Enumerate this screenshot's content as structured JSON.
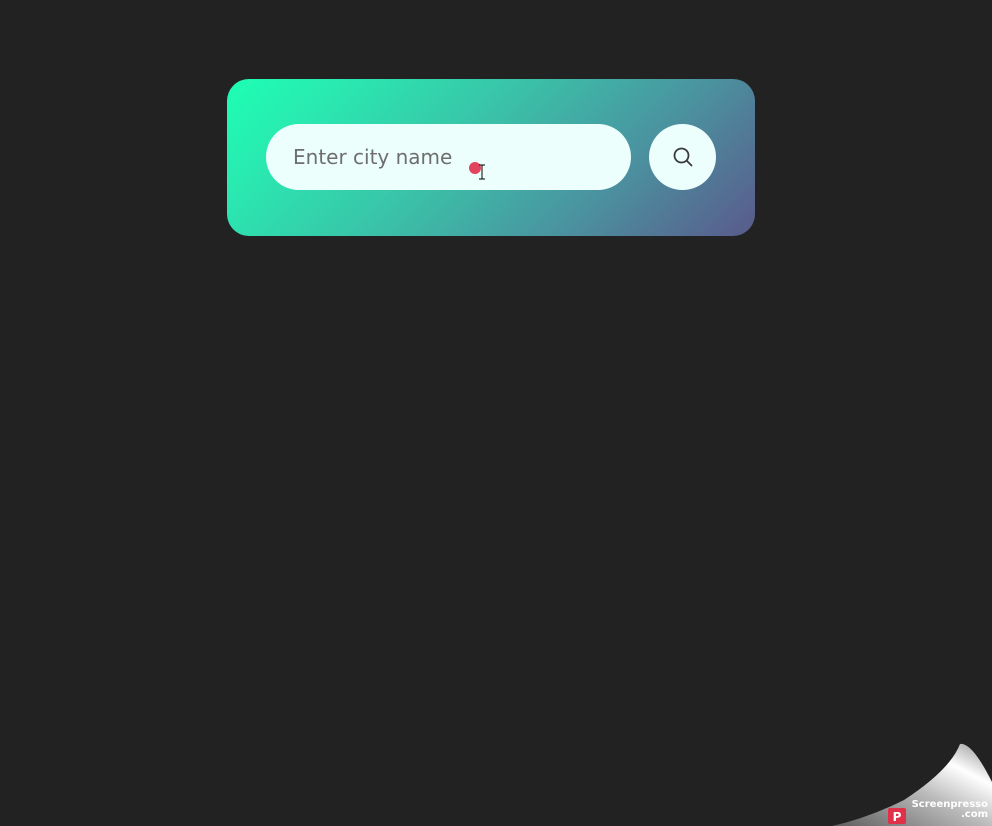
{
  "search": {
    "placeholder": "Enter city name",
    "value": "",
    "button_icon": "search-icon"
  },
  "watermark": {
    "brand": "Screenpresso",
    "domain": ".com"
  },
  "colors": {
    "background": "#222222",
    "card_gradient_start": "#1dffb3",
    "card_gradient_end": "#5a5a8c",
    "input_background": "#ecfffc"
  }
}
